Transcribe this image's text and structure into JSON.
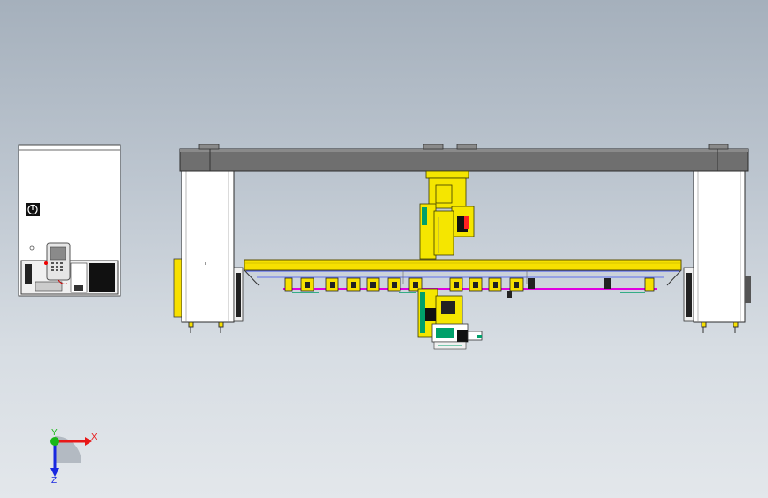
{
  "viewport": {
    "name": "cad-3d-viewport",
    "background": "#bcc5cf"
  },
  "scene": {
    "cabinet": {
      "fill": "#ffffff",
      "panel": "#1a1a1a",
      "icon": "power-symbol-icon"
    },
    "pendant": {
      "fill": "#e6e6e6",
      "screen": "#6f6f6f"
    },
    "gantry_beam": {
      "fill": "#6f6f6f",
      "edge": "#2b2b2b"
    },
    "columns": {
      "fill": "#ffffff",
      "edge": "#2b2b2b"
    },
    "rail": {
      "fill": "#f7e000",
      "edge": "#5a5000"
    },
    "robot": {
      "fill": "#f5e600",
      "accent": "#ff0000",
      "base": "#00a06a"
    },
    "cable": {
      "fill": "#e000e0"
    },
    "blue_line": "#3a4ef0"
  },
  "triad": {
    "x_label": "X",
    "y_label": "Y",
    "z_label": "Z",
    "x_color": "#e81818",
    "y_color": "#18b818",
    "z_color": "#1828e0"
  }
}
